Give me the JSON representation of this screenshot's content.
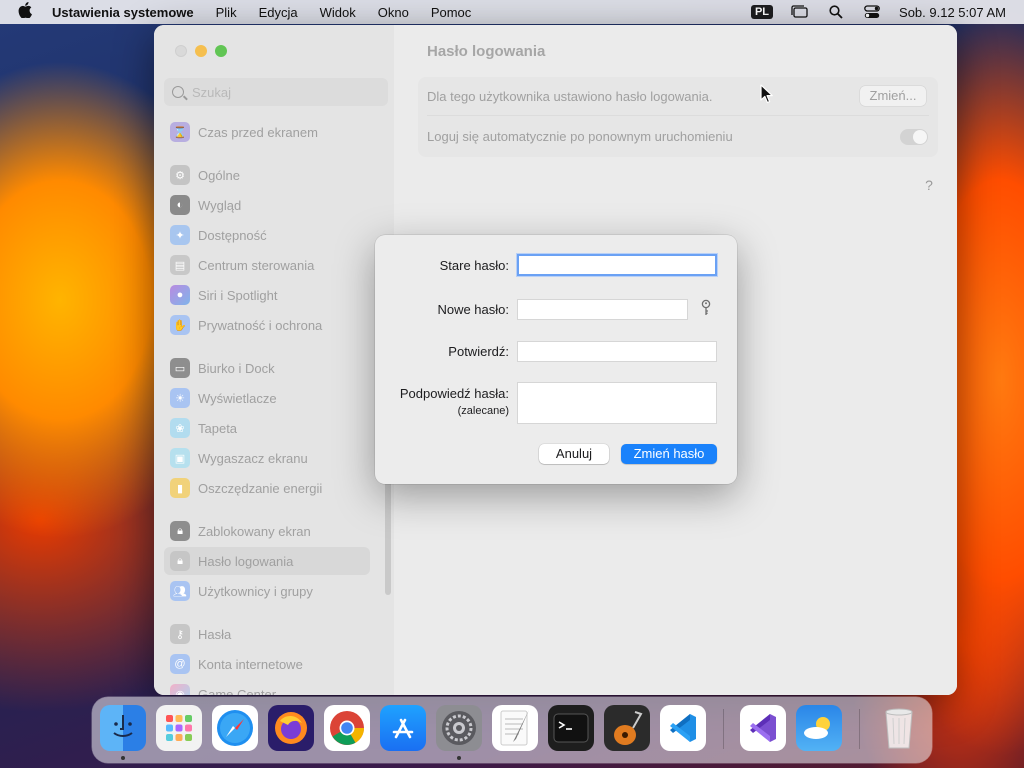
{
  "menubar": {
    "app_name": "Ustawienia systemowe",
    "menus": [
      "Plik",
      "Edycja",
      "Widok",
      "Okno",
      "Pomoc"
    ],
    "input_source": "PL",
    "datetime": "Sob. 9.12  5:07 AM"
  },
  "window": {
    "search_placeholder": "Szukaj",
    "sidebar_items": [
      {
        "label": "Czas przed ekranem",
        "icon": "hourglass-icon",
        "color": "#8e7cc3"
      },
      {
        "label": "Ogólne",
        "icon": "gear-icon",
        "color": "#9a9a9a"
      },
      {
        "label": "Wygląd",
        "icon": "appearance-icon",
        "color": "#2b2b2b"
      },
      {
        "label": "Dostępność",
        "icon": "accessibility-icon",
        "color": "#1a7cf2"
      },
      {
        "label": "Centrum sterowania",
        "icon": "control-center-icon",
        "color": "#9a9a9a"
      },
      {
        "label": "Siri i Spotlight",
        "icon": "siri-icon",
        "color": "#c85ad8"
      },
      {
        "label": "Prywatność i ochrona",
        "icon": "hand-icon",
        "color": "#3478f6"
      },
      {
        "label": "Biurko i Dock",
        "icon": "dock-icon",
        "color": "#2b2b2b"
      },
      {
        "label": "Wyświetlacze",
        "icon": "sun-icon",
        "color": "#3478f6"
      },
      {
        "label": "Tapeta",
        "icon": "wallpaper-icon",
        "color": "#49b6e8"
      },
      {
        "label": "Wygaszacz ekranu",
        "icon": "screensaver-icon",
        "color": "#5ac8e8"
      },
      {
        "label": "Oszczędzanie energii",
        "icon": "battery-icon",
        "color": "#f5b400"
      },
      {
        "label": "Zablokowany ekran",
        "icon": "lock-icon",
        "color": "#2b2b2b"
      },
      {
        "label": "Hasło logowania",
        "icon": "lock-icon",
        "color": "#9a9a9a"
      },
      {
        "label": "Użytkownicy i grupy",
        "icon": "users-icon",
        "color": "#3478f6"
      },
      {
        "label": "Hasła",
        "icon": "key-icon",
        "color": "#9a9a9a"
      },
      {
        "label": "Konta internetowe",
        "icon": "at-icon",
        "color": "#3478f6"
      },
      {
        "label": "Game Center",
        "icon": "game-center-icon",
        "color": "#e0e0e0"
      }
    ],
    "title": "Hasło logowania",
    "row1_text": "Dla tego użytkownika ustawiono hasło logowania.",
    "row1_button": "Zmień...",
    "row2_text": "Loguj się automatycznie po ponownym uruchomieniu",
    "help": "?"
  },
  "dialog": {
    "old_password_label": "Stare hasło:",
    "new_password_label": "Nowe hasło:",
    "confirm_label": "Potwierdź:",
    "hint_label": "Podpowiedź hasła:",
    "hint_sub": "(zalecane)",
    "old_password_value": "",
    "new_password_value": "",
    "confirm_value": "",
    "hint_value": "",
    "cancel": "Anuluj",
    "ok": "Zmień hasło"
  },
  "dock": {
    "apps": [
      "Finder",
      "Launchpad",
      "Safari",
      "Firefox",
      "Chrome",
      "App Store",
      "Ustawienia systemowe",
      "TextEdit",
      "Terminal",
      "GarageBand",
      "Visual Studio Code",
      "Visual Studio",
      "Pogoda",
      "Kosz"
    ]
  }
}
